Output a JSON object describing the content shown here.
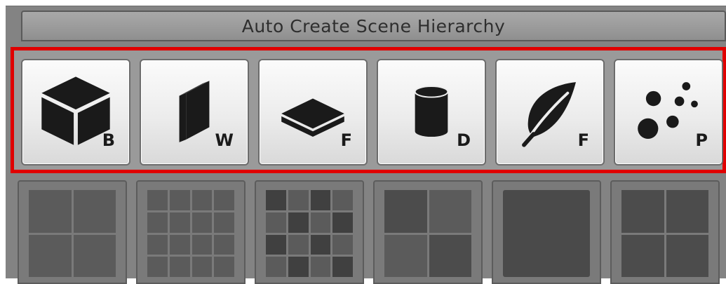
{
  "panel": {
    "title": "Auto Create Scene Hierarchy"
  },
  "toolbar": {
    "buttons": [
      {
        "icon": "box-icon",
        "letter": "B"
      },
      {
        "icon": "wall-icon",
        "letter": "W"
      },
      {
        "icon": "floor-icon",
        "letter": "F"
      },
      {
        "icon": "cylinder-icon",
        "letter": "D"
      },
      {
        "icon": "leaf-icon",
        "letter": "F"
      },
      {
        "icon": "particles-icon",
        "letter": "P"
      }
    ]
  },
  "colors": {
    "highlight_border": "#e00000",
    "panel_bg": "#838383",
    "button_face": "#ececec",
    "icon": "#1a1a1a",
    "tile_cell": "#5b5b5b"
  }
}
